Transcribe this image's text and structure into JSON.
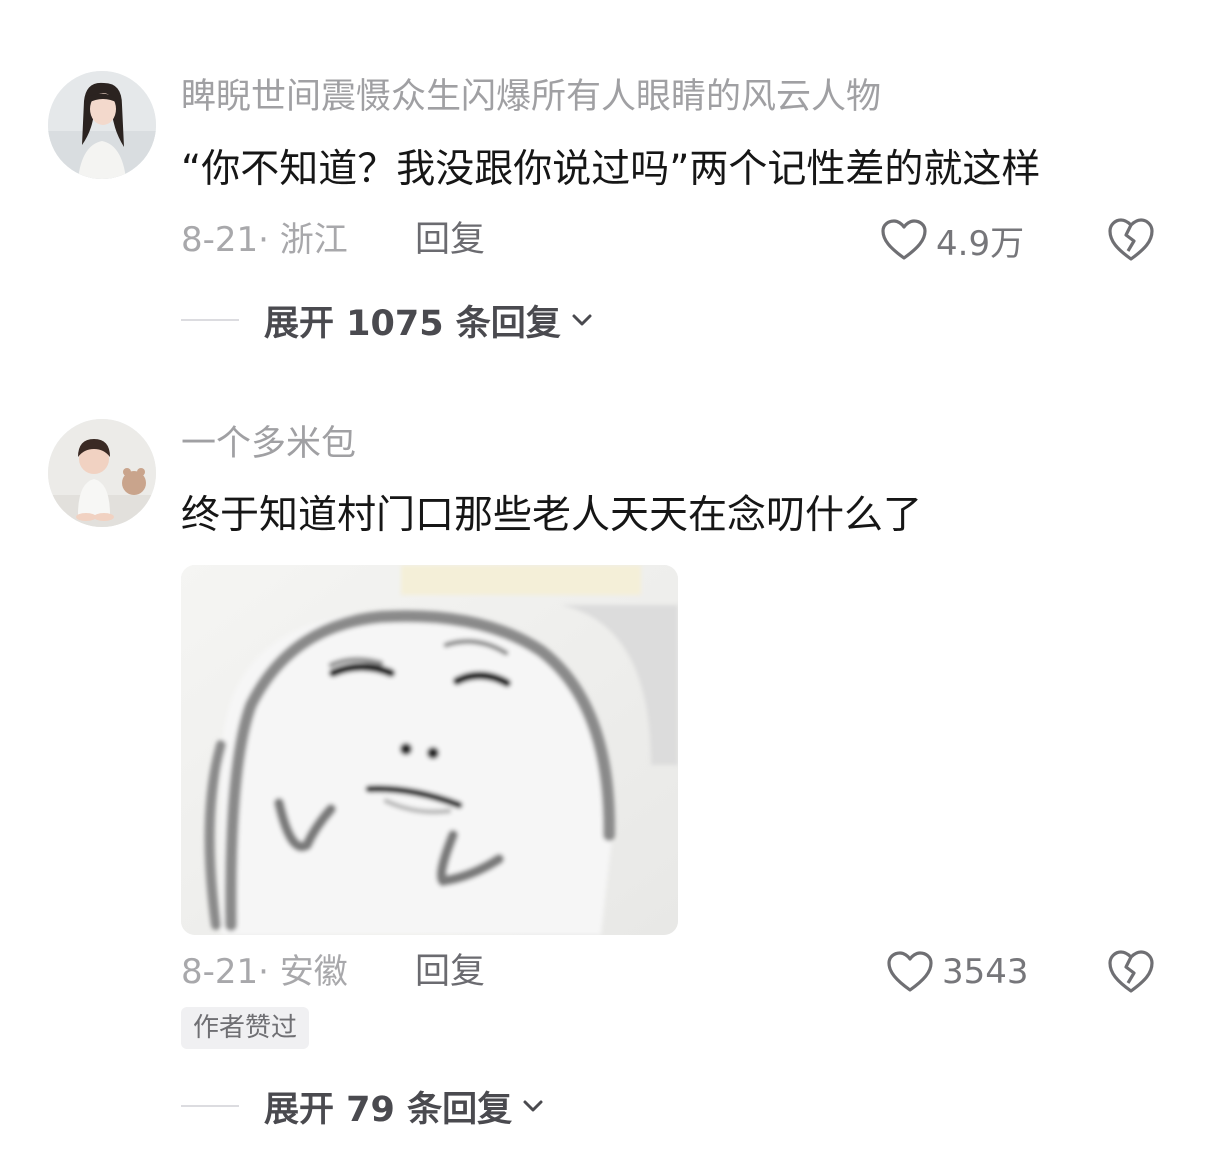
{
  "comments": [
    {
      "username": "睥睨世间震慑众生闪爆所有人眼睛的风云人物",
      "text": "“你不知道？我没跟你说过吗”两个记性差的就这样",
      "date_location": "8-21· 浙江",
      "reply_label": "回复",
      "likes": "4.9万",
      "like_icon": "heart-outline-icon",
      "dislike_icon": "broken-heart-icon",
      "expand_label": "展开 1075 条回复"
    },
    {
      "username": "一个多米包",
      "text": "终于知道村门口那些老人天天在念叨什么了",
      "image": "meme-face-image",
      "date_location": "8-21· 安徽",
      "reply_label": "回复",
      "likes": "3543",
      "badge": "作者赞过",
      "like_icon": "heart-outline-icon",
      "dislike_icon": "broken-heart-icon",
      "expand_label": "展开 79 条回复"
    }
  ],
  "colors": {
    "username": "#a0a0a3",
    "text": "#161616",
    "meta": "#a8a8ab",
    "reply": "#6b6b70",
    "icon": "#6f6f73"
  }
}
